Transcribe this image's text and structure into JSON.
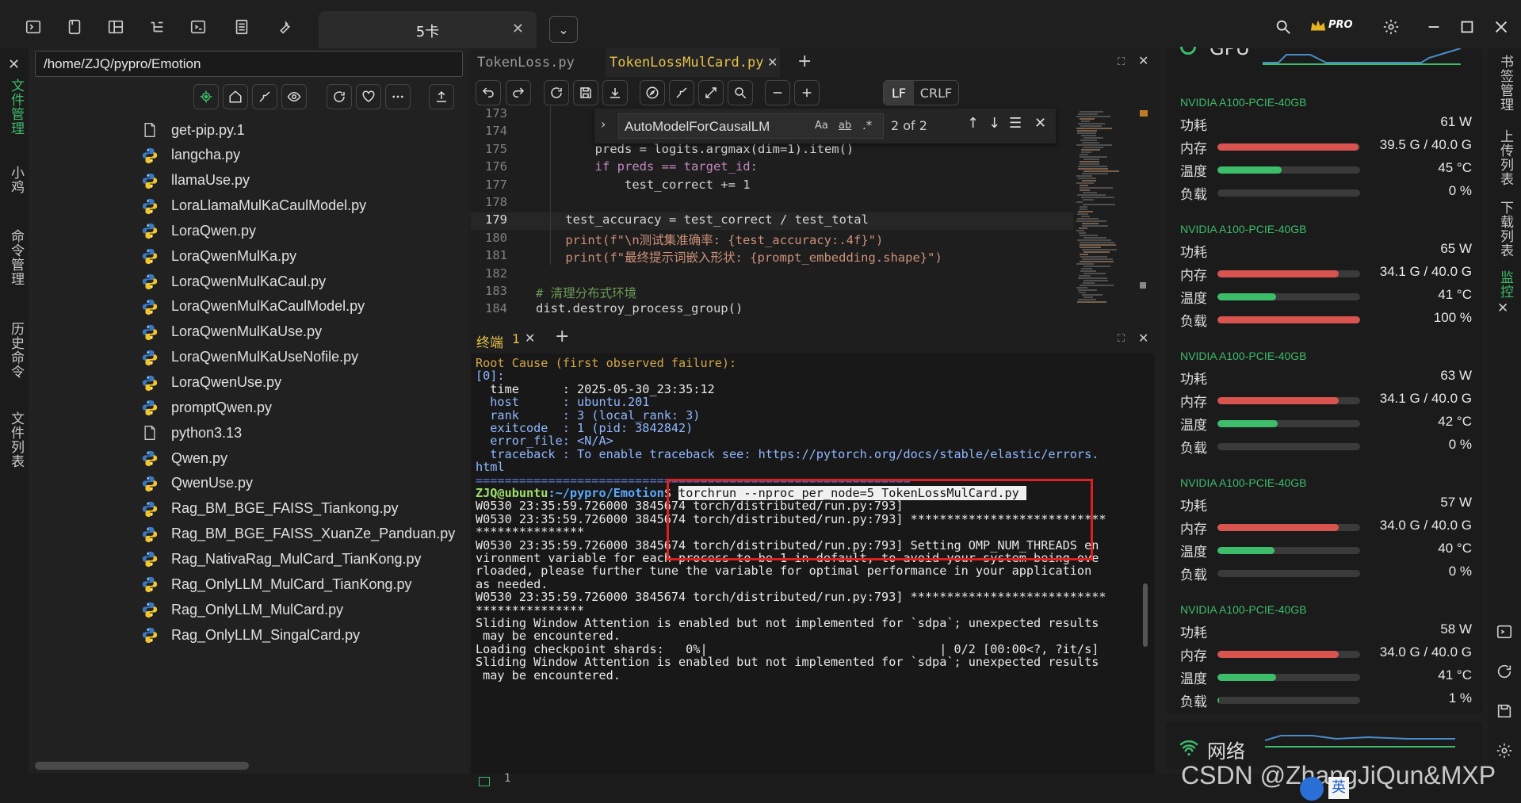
{
  "window": {
    "active_tab": "5卡",
    "pro_badge": "PRO"
  },
  "left_strip": {
    "labels": [
      "文件管理",
      "小鸡",
      "命令管理",
      "历史命令",
      "文件列表"
    ]
  },
  "file_panel": {
    "path": "/home/ZJQ/pypro/Emotion",
    "files": [
      {
        "name": "get-pip.py.1",
        "type": "file"
      },
      {
        "name": "langcha.py",
        "type": "python"
      },
      {
        "name": "llamaUse.py",
        "type": "python"
      },
      {
        "name": "LoraLlamaMulKaCaulModel.py",
        "type": "python"
      },
      {
        "name": "LoraQwen.py",
        "type": "python"
      },
      {
        "name": "LoraQwenMulKa.py",
        "type": "python"
      },
      {
        "name": "LoraQwenMulKaCaul.py",
        "type": "python"
      },
      {
        "name": "LoraQwenMulKaCaulModel.py",
        "type": "python"
      },
      {
        "name": "LoraQwenMulKaUse.py",
        "type": "python"
      },
      {
        "name": "LoraQwenMulKaUseNofile.py",
        "type": "python"
      },
      {
        "name": "LoraQwenUse.py",
        "type": "python"
      },
      {
        "name": "promptQwen.py",
        "type": "python"
      },
      {
        "name": "python3.13",
        "type": "file"
      },
      {
        "name": "Qwen.py",
        "type": "python"
      },
      {
        "name": "QwenUse.py",
        "type": "python"
      },
      {
        "name": "Rag_BM_BGE_FAISS_Tiankong.py",
        "type": "python"
      },
      {
        "name": "Rag_BM_BGE_FAISS_XuanZe_Panduan.py",
        "type": "python"
      },
      {
        "name": "Rag_NativaRag_MulCard_TianKong.py",
        "type": "python"
      },
      {
        "name": "Rag_OnlyLLM_MulCard_TianKong.py",
        "type": "python"
      },
      {
        "name": "Rag_OnlyLLM_MulCard.py",
        "type": "python"
      },
      {
        "name": "Rag_OnlyLLM_SingalCard.py",
        "type": "python"
      }
    ]
  },
  "editor": {
    "tabs": [
      "TokenLoss.py",
      "TokenLossMulCard.py"
    ],
    "lf": "LF",
    "crlf": "CRLF",
    "find": {
      "query": "AutoModelForCausalLM",
      "opt_case": "Aa",
      "opt_word": "ab",
      "opt_regex": ".*",
      "count": "2 of 2"
    },
    "lines": [
      {
        "n": "173",
        "t": ""
      },
      {
        "n": "174",
        "t": ""
      },
      {
        "n": "175",
        "t": "        preds = logits.argmax(dim=1).item()"
      },
      {
        "n": "176",
        "t": "        if preds == target_id:"
      },
      {
        "n": "177",
        "t": "            test_correct += 1"
      },
      {
        "n": "178",
        "t": ""
      },
      {
        "n": "179",
        "t": "    test_accuracy = test_correct / test_total"
      },
      {
        "n": "180",
        "t": "    print(f\"\\n测试集准确率: {test_accuracy:.4f}\")"
      },
      {
        "n": "181",
        "t": "    print(f\"最终提示词嵌入形状: {prompt_embedding.shape}\")"
      },
      {
        "n": "182",
        "t": ""
      },
      {
        "n": "183",
        "t": "# 清理分布式环境"
      },
      {
        "n": "184",
        "t": "dist.destroy_process_group()"
      }
    ]
  },
  "terminal": {
    "tab_label": "终端",
    "tab_num": "1",
    "lines": [
      "Root Cause (first observed failure):",
      "[0]:",
      "  time      : 2025-05-30_23:35:12",
      "  host      : ubuntu.201",
      "  rank      : 3 (local_rank: 3)",
      "  exitcode  : 1 (pid: 3842842)",
      "  error_file: <N/A>",
      "  traceback : To enable traceback see: https://pytorch.org/docs/stable/elastic/errors.",
      "html",
      "============================================================",
      "ZJQ@ubuntu:~/pypro/Emotion$ torchrun --nproc_per_node=5 TokenLossMulCard.py",
      "W0530 23:35:59.726000 3845674 torch/distributed/run.py:793]",
      "W0530 23:35:59.726000 3845674 torch/distributed/run.py:793] ***************************",
      "***************",
      "W0530 23:35:59.726000 3845674 torch/distributed/run.py:793] Setting OMP_NUM_THREADS en",
      "vironment variable for each process to be 1 in default, to avoid your system being ove",
      "rloaded, please further tune the variable for optimal performance in your application",
      "as needed.",
      "W0530 23:35:59.726000 3845674 torch/distributed/run.py:793] ***************************",
      "***************",
      "Sliding Window Attention is enabled but not implemented for `sdpa`; unexpected results",
      " may be encountered.",
      "Loading checkpoint shards:   0%|                                | 0/2 [00:00<?, ?it/s]",
      "Sliding Window Attention is enabled but not implemented for `sdpa`; unexpected results",
      " may be encountered."
    ],
    "prompt_user": "ZJQ@ubuntu",
    "prompt_path": ":~/pypro/Emotion",
    "prompt_sym": "$ ",
    "command": "torchrun --nproc_per_node=5 TokenLossMulCard.py ",
    "bottom_num": "1"
  },
  "gpus": [
    {
      "name": "NVIDIA A100-PCIE-40GB",
      "power": "61 W",
      "mem": "39.5 G / 40.0 G",
      "mem_frac": 0.987,
      "temp": "45 °C",
      "temp_frac": 0.45,
      "load": "0 %",
      "load_frac": 0
    },
    {
      "name": "NVIDIA A100-PCIE-40GB",
      "power": "65 W",
      "mem": "34.1 G / 40.0 G",
      "mem_frac": 0.85,
      "temp": "41 °C",
      "temp_frac": 0.41,
      "load": "100 %",
      "load_frac": 1
    },
    {
      "name": "NVIDIA A100-PCIE-40GB",
      "power": "63 W",
      "mem": "34.1 G / 40.0 G",
      "mem_frac": 0.85,
      "temp": "42 °C",
      "temp_frac": 0.42,
      "load": "0 %",
      "load_frac": 0
    },
    {
      "name": "NVIDIA A100-PCIE-40GB",
      "power": "57 W",
      "mem": "34.0 G / 40.0 G",
      "mem_frac": 0.85,
      "temp": "40 °C",
      "temp_frac": 0.4,
      "load": "0 %",
      "load_frac": 0
    },
    {
      "name": "NVIDIA A100-PCIE-40GB",
      "power": "58 W",
      "mem": "34.0 G / 40.0 G",
      "mem_frac": 0.85,
      "temp": "41 °C",
      "temp_frac": 0.41,
      "load": "1 %",
      "load_frac": 0.01
    }
  ],
  "gpu_labels": {
    "power": "功耗",
    "mem": "内存",
    "temp": "温度",
    "load": "负载"
  },
  "gpu_header_partial": "GPU",
  "network": {
    "label": "网络"
  },
  "right_strip": {
    "labels": [
      "书签管理",
      "上传列表",
      "下载列表",
      "监控"
    ]
  },
  "watermark": "CSDN @ZhangJiQun&MXP",
  "ime": {
    "lang": "英"
  },
  "colors": {
    "green": "#3dbc6a",
    "red": "#d9534f",
    "accent_tab": "#e6c34a"
  }
}
